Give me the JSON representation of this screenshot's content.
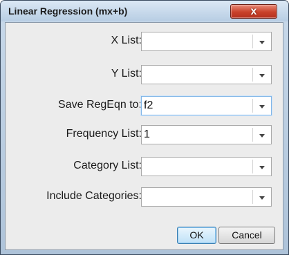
{
  "window": {
    "title": "Linear Regression (mx+b)",
    "close_icon": "close-x-icon",
    "close_glyph": "x"
  },
  "form": {
    "fields": [
      {
        "label": "X List:",
        "value": ""
      },
      {
        "label": "Y List:",
        "value": ""
      },
      {
        "label": "Save RegEqn to:",
        "value": "f2"
      },
      {
        "label": "Frequency List:",
        "value": "1"
      },
      {
        "label": "Category List:",
        "value": ""
      },
      {
        "label": "Include Categories:",
        "value": ""
      }
    ]
  },
  "buttons": {
    "ok": "OK",
    "cancel": "Cancel"
  },
  "colors": {
    "title_bar": "#c8d9ea",
    "close_button": "#c9412a",
    "dialog_body": "#ececec",
    "focused_field_border": "#7fb5e8"
  }
}
